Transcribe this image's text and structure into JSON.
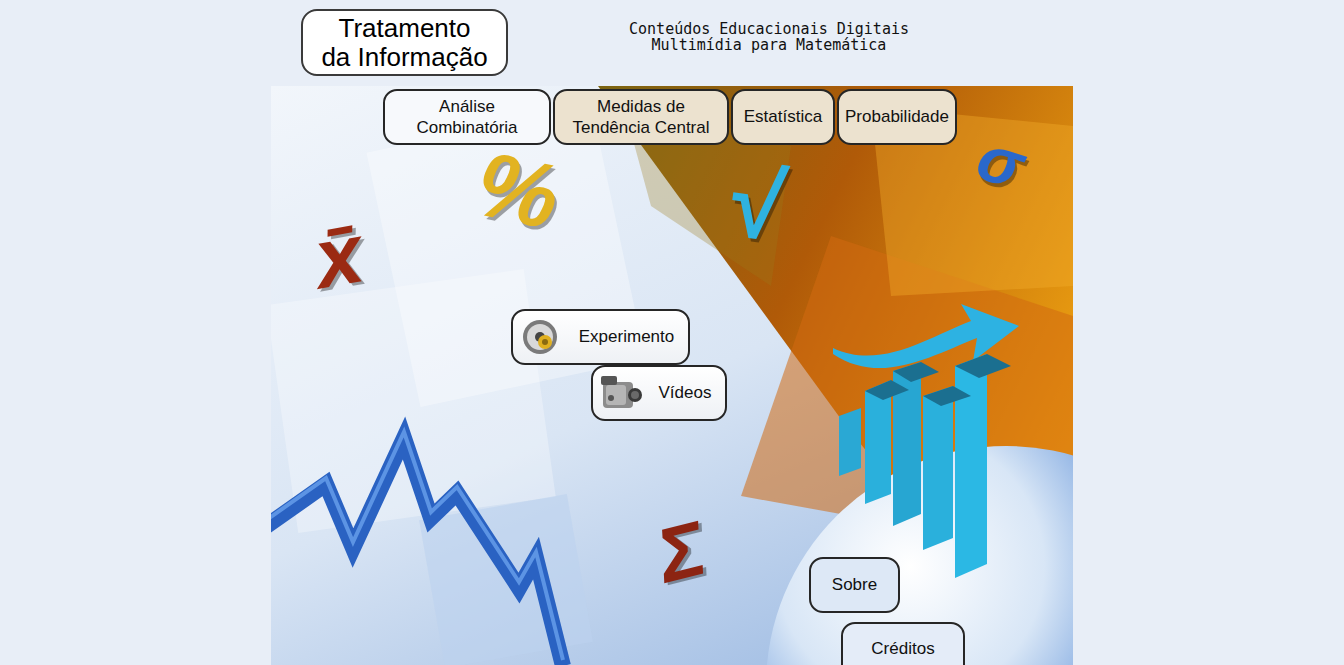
{
  "header": {
    "title_lines": [
      "Tratamento",
      "da Informação"
    ],
    "subtitle_lines": [
      "Conteúdos Educacionais Digitais",
      "Multimídia para Matemática"
    ]
  },
  "nav": [
    {
      "label_lines": [
        "Análise",
        "Combinatória"
      ],
      "selected": true
    },
    {
      "label_lines": [
        "Medidas de",
        "Tendência Central"
      ],
      "selected": false
    },
    {
      "label_lines": [
        "Estatística"
      ],
      "selected": false
    },
    {
      "label_lines": [
        "Probabilidade"
      ],
      "selected": false
    }
  ],
  "actions": [
    {
      "label": "Experimento",
      "kind": "experiment"
    },
    {
      "label": "Vídeos",
      "kind": "video"
    }
  ],
  "footer_buttons": [
    "Sobre",
    "Créditos"
  ],
  "decorations": [
    {
      "symbol": "%",
      "color": "#e2b321"
    },
    {
      "symbol": "x̄",
      "color": "#9b2a12"
    },
    {
      "symbol": "√",
      "color": "#2fb2e0"
    },
    {
      "symbol": "σ",
      "color": "#2a68cc"
    },
    {
      "symbol": "Σ",
      "color": "#8c2412"
    }
  ]
}
